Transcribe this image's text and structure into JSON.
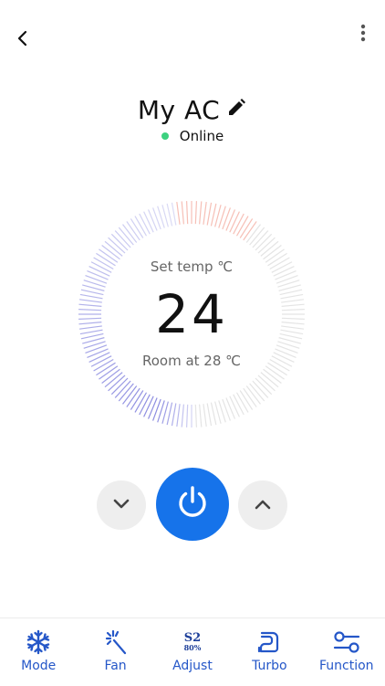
{
  "header": {
    "back_icon": "chevron-left-icon",
    "more_icon": "more-vertical-icon"
  },
  "device": {
    "name": "My AC",
    "edit_icon": "pencil-icon",
    "status": "Online",
    "status_color": "#3dd17f"
  },
  "thermostat": {
    "set_label": "Set temp ℃",
    "set_temperature": "24",
    "room_label": "Room at 28 ℃",
    "accent_cool": "#6f6fd8",
    "accent_warm": "#ef8a7a"
  },
  "controls": {
    "down_icon": "chevron-down-icon",
    "power_icon": "power-icon",
    "up_icon": "chevron-up-icon",
    "power_color": "#1673ea"
  },
  "tabs": [
    {
      "label": "Mode",
      "icon": "snowflake-icon"
    },
    {
      "label": "Fan",
      "icon": "fan-icon"
    },
    {
      "label": "Adjust",
      "icon": "adjust-icon",
      "icon_text": "S2",
      "icon_subtext": "80%"
    },
    {
      "label": "Turbo",
      "icon": "turbo-icon"
    },
    {
      "label": "Function",
      "icon": "function-icon"
    }
  ]
}
